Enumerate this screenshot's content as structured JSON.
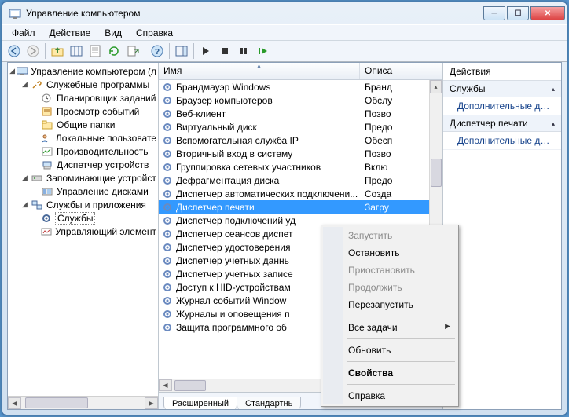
{
  "titlebar": {
    "title": "Управление компьютером"
  },
  "menubar": [
    "Файл",
    "Действие",
    "Вид",
    "Справка"
  ],
  "tree": {
    "root": "Управление компьютером (л",
    "group1": "Служебные программы",
    "g1items": [
      "Планировщик заданий",
      "Просмотр событий",
      "Общие папки",
      "Локальные пользовате",
      "Производительность",
      "Диспетчер устройств"
    ],
    "group2": "Запоминающие устройст",
    "g2items": [
      "Управление дисками"
    ],
    "group3": "Службы и приложения",
    "g3items": [
      "Службы",
      "Управляющий элемент"
    ]
  },
  "list": {
    "col_name": "Имя",
    "col_desc": "Описа",
    "rows": [
      {
        "name": "Брандмауэр Windows",
        "desc": "Бранд"
      },
      {
        "name": "Браузер компьютеров",
        "desc": "Обслу"
      },
      {
        "name": "Веб-клиент",
        "desc": "Позво"
      },
      {
        "name": "Виртуальный диск",
        "desc": "Предо"
      },
      {
        "name": "Вспомогательная служба IP",
        "desc": "Обесп"
      },
      {
        "name": "Вторичный вход в систему",
        "desc": "Позво"
      },
      {
        "name": "Группировка сетевых участников",
        "desc": "Вклю"
      },
      {
        "name": "Дефрагментация диска",
        "desc": "Предо"
      },
      {
        "name": "Диспетчер автоматических подключени...",
        "desc": "Созда"
      },
      {
        "name": "Диспетчер печати",
        "desc": "Загру"
      },
      {
        "name": "Диспетчер подключений уд",
        "desc": ""
      },
      {
        "name": "Диспетчер сеансов диспет",
        "desc": ""
      },
      {
        "name": "Диспетчер удостоверения",
        "desc": ""
      },
      {
        "name": "Диспетчер учетных даннь",
        "desc": ""
      },
      {
        "name": "Диспетчер учетных записе",
        "desc": ""
      },
      {
        "name": "Доступ к HID-устройствам",
        "desc": ""
      },
      {
        "name": "Журнал событий Window",
        "desc": ""
      },
      {
        "name": "Журналы и оповещения п",
        "desc": ""
      },
      {
        "name": "Защита программного об",
        "desc": ""
      }
    ],
    "selected": 9,
    "tabs": [
      "Расширенный",
      "Стандартнь"
    ]
  },
  "actions": {
    "title": "Действия",
    "section1": "Службы",
    "item1": "Дополнительные дей...",
    "section2": "Диспетчер печати",
    "item2": "Дополнительные дей..."
  },
  "context_menu": {
    "items": [
      {
        "label": "Запустить",
        "disabled": true
      },
      {
        "label": "Остановить"
      },
      {
        "label": "Приостановить",
        "disabled": true
      },
      {
        "label": "Продолжить",
        "disabled": true
      },
      {
        "label": "Перезапустить"
      },
      {
        "sep": true
      },
      {
        "label": "Все задачи",
        "submenu": true
      },
      {
        "sep": true
      },
      {
        "label": "Обновить"
      },
      {
        "sep": true
      },
      {
        "label": "Свойства",
        "bold": true
      },
      {
        "sep": true
      },
      {
        "label": "Справка"
      }
    ]
  }
}
